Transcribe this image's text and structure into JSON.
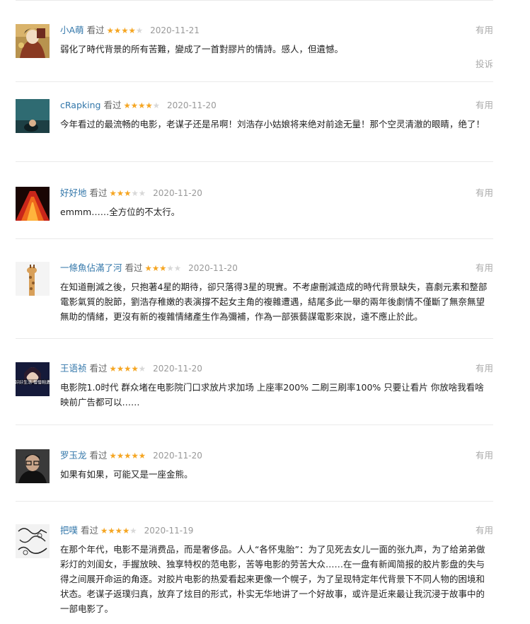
{
  "labels": {
    "status": "看过",
    "useful": "有用",
    "report": "投诉"
  },
  "colors": {
    "username": "#3377aa",
    "star_on": "#f5a623",
    "star_off": "#d8d8d8",
    "muted": "#999999"
  },
  "comments": [
    {
      "user": "小A萌",
      "status": "看过",
      "rating": 4,
      "date": "2020-11-21",
      "text": "弱化了時代背景的所有苦難，變成了一首對膠片的情詩。感人，但遺憾。",
      "useful": "有用",
      "report": "投诉",
      "avatar_icon": "painted-portrait-avatar"
    },
    {
      "user": "cRapking",
      "status": "看过",
      "rating": 4,
      "date": "2020-11-20",
      "text": "今年看过的最流畅的电影，老谋子还是吊啊！刘浩存小姑娘将来绝对前途无量！那个空灵清澈的眼睛，绝了！",
      "useful": "有用",
      "avatar_icon": "teal-figure-avatar"
    },
    {
      "user": "好好地",
      "status": "看过",
      "rating": 3,
      "date": "2020-11-20",
      "text": "emmm……全方位的不太行。",
      "useful": "有用",
      "avatar_icon": "stage-lights-avatar"
    },
    {
      "user": "一條魚佔滿了河",
      "status": "看过",
      "rating": 3,
      "date": "2020-11-20",
      "text": "在知道刪減之後，只抱著4星的期待，卻只落得3星的現實。不考慮刪減造成的時代背景缺失，喜劇元素和整部電影氣質的脫節，劉浩存稚嫩的表演撐不起女主角的複雜遭遇，結尾多此一舉的兩年後劇情不僅斷了無奈無望無助的情緒，更沒有新的複雜情緒產生作為彌補，作為一部張藝謀電影來說，遠不應止於此。",
      "useful": "有用",
      "avatar_icon": "giraffe-avatar"
    },
    {
      "user": "王语祯",
      "status": "看过",
      "rating": 4,
      "date": "2020-11-20",
      "text": "电影院1.0时代 群众堵在电影院门口求放片求加场 上座率200% 二刷三刷率100% 只要让看片 你放啥我看啥 映前广告都可以……",
      "useful": "有用",
      "avatar_caption": "好好生活 慢慢相遇",
      "avatar_icon": "girl-caption-avatar"
    },
    {
      "user": "罗玉龙",
      "status": "看过",
      "rating": 5,
      "date": "2020-11-20",
      "text": "如果有如果，可能又是一座金熊。",
      "useful": "有用",
      "avatar_icon": "man-glasses-avatar"
    },
    {
      "user": "把噗",
      "status": "看过",
      "rating": 4,
      "date": "2020-11-19",
      "text": "在那个年代，电影不是消费品，而是奢侈品。人人“各怀鬼胎”：为了见死去女儿一面的张九声，为了给弟弟做彩灯的刘闺女，手握放映、独享特权的范电影，苦等电影的劳苦大众……在一盘有新闻简报的胶片影盘的失与得之间展开命运的角逐。对胶片电影的热爱看起来更像一个幌子，为了呈现特定年代背景下不同人物的困境和状态。老谋子返璞归真，放弃了炫目的形式，朴实无华地讲了一个好故事，或许是近来最让我沉浸于故事中的一部电影了。",
      "useful": "有用",
      "avatar_icon": "sketch-avatar"
    }
  ]
}
